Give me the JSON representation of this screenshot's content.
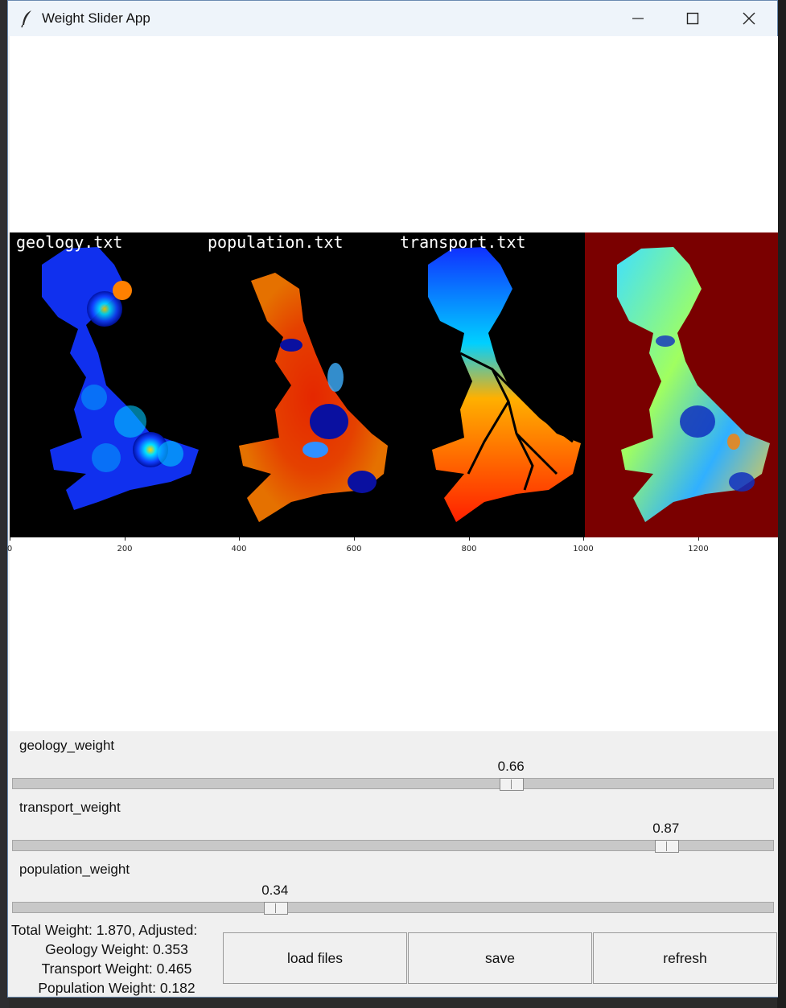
{
  "window": {
    "title": "Weight Slider App"
  },
  "figure": {
    "panel_labels": [
      "geology.txt",
      "population.txt",
      "transport.txt"
    ],
    "x_ticks": [
      "0",
      "200",
      "400",
      "600",
      "800",
      "1000",
      "1200"
    ]
  },
  "sliders": [
    {
      "label": "geology_weight",
      "value": "0.66",
      "fraction": 0.66
    },
    {
      "label": "transport_weight",
      "value": "0.87",
      "fraction": 0.87
    },
    {
      "label": "population_weight",
      "value": "0.34",
      "fraction": 0.34
    }
  ],
  "summary": {
    "line0": "Total Weight: 1.870, Adjusted:",
    "line1": "Geology Weight: 0.353",
    "line2": "Transport Weight: 0.465",
    "line3": "Population Weight: 0.182"
  },
  "buttons": {
    "load": "load files",
    "save": "save",
    "refresh": "refresh"
  }
}
